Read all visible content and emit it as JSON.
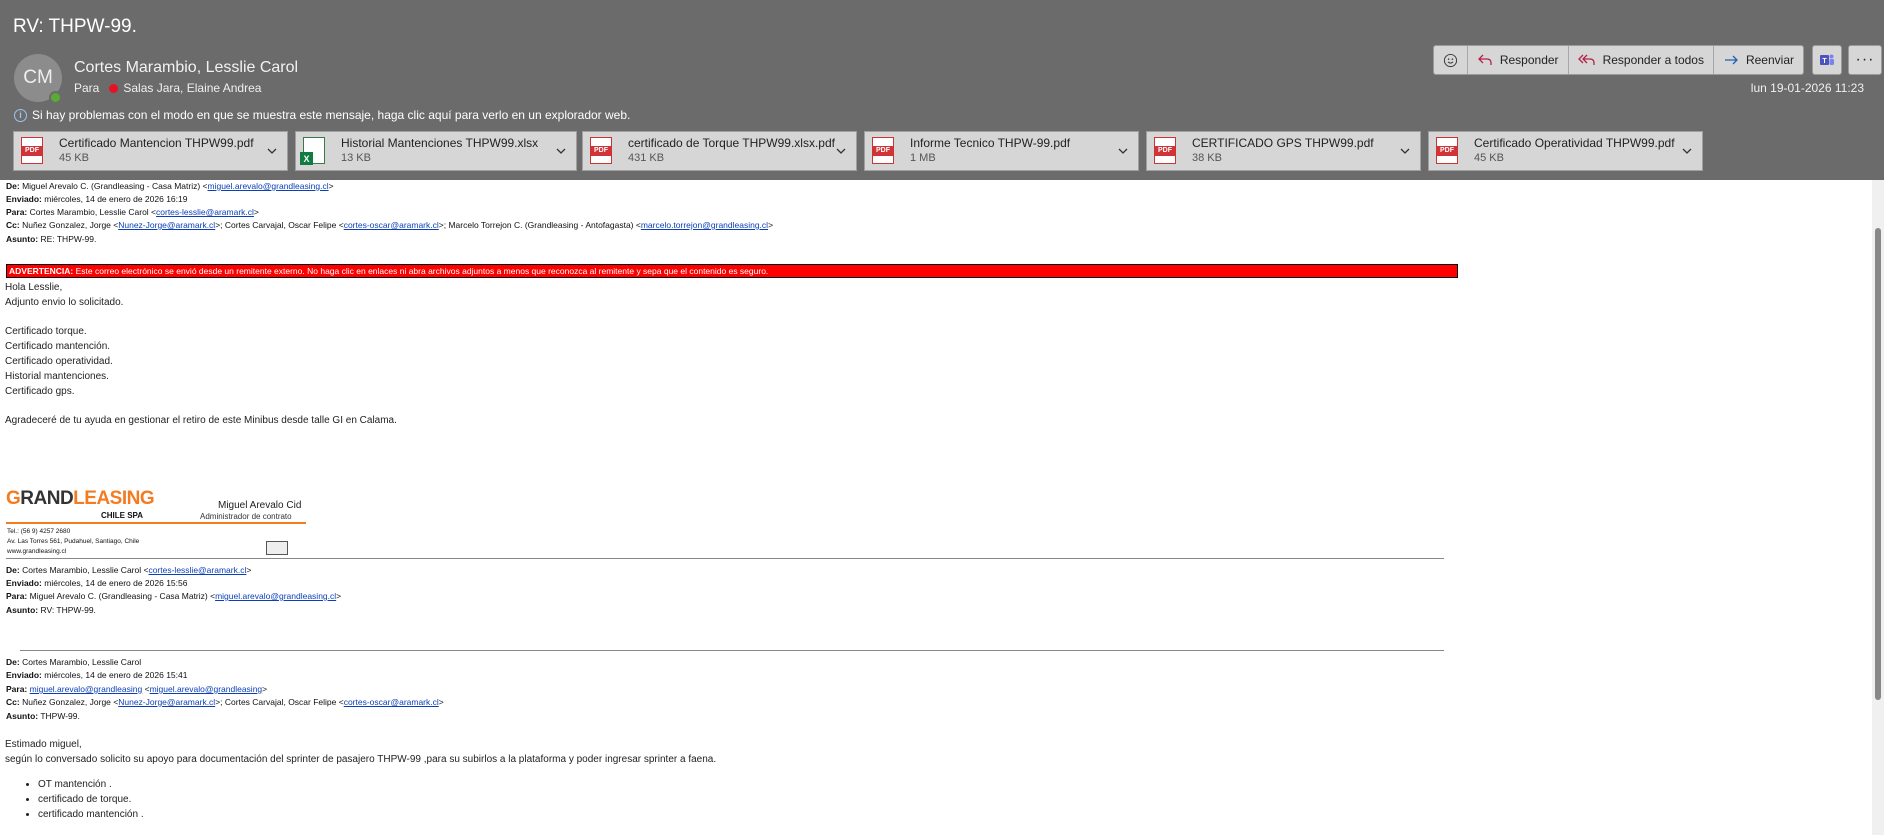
{
  "subject": "RV: THPW-99.",
  "sender": {
    "initials": "CM",
    "name": "Cortes Marambio, Lesslie Carol"
  },
  "to": {
    "label": "Para",
    "name": "Salas Jara, Elaine Andrea"
  },
  "actions": {
    "reply": "Responder",
    "reply_all": "Responder a todos",
    "forward": "Reenviar"
  },
  "date": "lun 19-01-2026 11:23",
  "info_bar": "Si hay problemas con el modo en que se muestra este mensaje, haga clic aquí para verlo en un explorador web.",
  "attachments": [
    {
      "name": "Certificado Mantencion THPW99.pdf",
      "size": "45 KB",
      "type": "pdf"
    },
    {
      "name": "Historial Mantenciones THPW99.xlsx",
      "size": "13 KB",
      "type": "xlsx"
    },
    {
      "name": "certificado de Torque THPW99.xlsx.pdf",
      "size": "431 KB",
      "type": "pdf"
    },
    {
      "name": "Informe Tecnico THPW-99.pdf",
      "size": "1 MB",
      "type": "pdf"
    },
    {
      "name": "CERTIFICADO GPS THPW99.pdf",
      "size": "38 KB",
      "type": "pdf"
    },
    {
      "name": "Certificado Operatividad THPW99.pdf",
      "size": "45 KB",
      "type": "pdf"
    }
  ],
  "msg1": {
    "from_label": "De:",
    "from": "Miguel Arevalo C. (Grandleasing - Casa Matriz) <",
    "from_email": "miguel.arevalo@grandleasing.cl",
    "from_end": ">",
    "sent_label": "Enviado:",
    "sent": "miércoles, 14 de enero de 2026 16:19",
    "to_label": "Para:",
    "to": "Cortes Marambio, Lesslie Carol <",
    "to_email": "cortes-lesslie@aramark.cl",
    "to_end": ">",
    "cc_label": "Cc:",
    "cc1": "Nuñez Gonzalez, Jorge <",
    "cc1_email": "Nunez-Jorge@aramark.cl",
    "cc2": ">; Cortes Carvajal, Oscar Felipe <",
    "cc2_email": "cortes-oscar@aramark.cl",
    "cc3": ">; Marcelo Torrejon C. (Grandleasing - Antofagasta) <",
    "cc3_email": "marcelo.torrejon@grandleasing.cl",
    "cc_end": ">",
    "subj_label": "Asunto:",
    "subj": "RE: THPW-99.",
    "warning_label": "ADVERTENCIA:",
    "warning": " Este correo electrónico se envió desde un remitente externo. No haga clic en enlaces ni abra archivos adjuntos a menos que reconozca al remitente y sepa que el contenido es seguro.",
    "lines": [
      "Hola Lesslie,",
      "Adjunto envio lo solicitado.",
      "Certificado torque.",
      "Certificado mantención.",
      "Certificado operatividad.",
      "Historial mantenciones.",
      "Certificado gps."
    ],
    "closing": "Agradeceré de tu ayuda en gestionar el retiro de este Minibus desde talle GI en Calama."
  },
  "signature": {
    "logo_a": "G",
    "logo_b": "RAND",
    "logo_c": "LEASING",
    "logo_sub": "CHILE SPA",
    "name": "Miguel Arevalo Cid",
    "role": "Administrador de contrato",
    "tel": "Tel.: (56 9) 4257 2680",
    "address": "Av. Las Torres 561, Pudahuel, Santiago, Chile",
    "web": "www.grandleasing.cl"
  },
  "msg2": {
    "from_label": "De:",
    "from": "Cortes Marambio, Lesslie Carol <",
    "from_email": "cortes-lesslie@aramark.cl",
    "from_end": ">",
    "sent_label": "Enviado:",
    "sent": "miércoles, 14 de enero de 2026 15:56",
    "to_label": "Para:",
    "to": "Miguel Arevalo C. (Grandleasing - Casa Matriz) <",
    "to_email": "miguel.arevalo@grandleasing.cl",
    "to_end": ">",
    "subj_label": "Asunto:",
    "subj": "RV: THPW-99."
  },
  "msg3": {
    "from_label": "De:",
    "from": "Cortes Marambio, Lesslie Carol",
    "sent_label": "Enviado:",
    "sent": "miércoles, 14 de enero de 2026 15:41",
    "to_label": "Para:",
    "to_email": "miguel.arevalo@grandleasing",
    "to_mid": " <",
    "to_email2": "miguel.arevalo@grandleasing",
    "to_end": ">",
    "cc_label": "Cc:",
    "cc1": "Nuñez Gonzalez, Jorge <",
    "cc1_email": "Nunez-Jorge@aramark.cl",
    "cc2": ">; Cortes Carvajal, Oscar Felipe <",
    "cc2_email": "cortes-oscar@aramark.cl",
    "cc_end": ">",
    "subj_label": "Asunto:",
    "subj": "THPW-99.",
    "greeting": "Estimado miguel,",
    "text": "según lo conversado solicito su apoyo para documentación del sprinter de pasajero THPW-99 ,para su subirlos a la plataforma y poder ingresar sprinter a faena.",
    "bullets": [
      "OT mantención .",
      "certificado de torque.",
      "certificado mantención ."
    ]
  }
}
